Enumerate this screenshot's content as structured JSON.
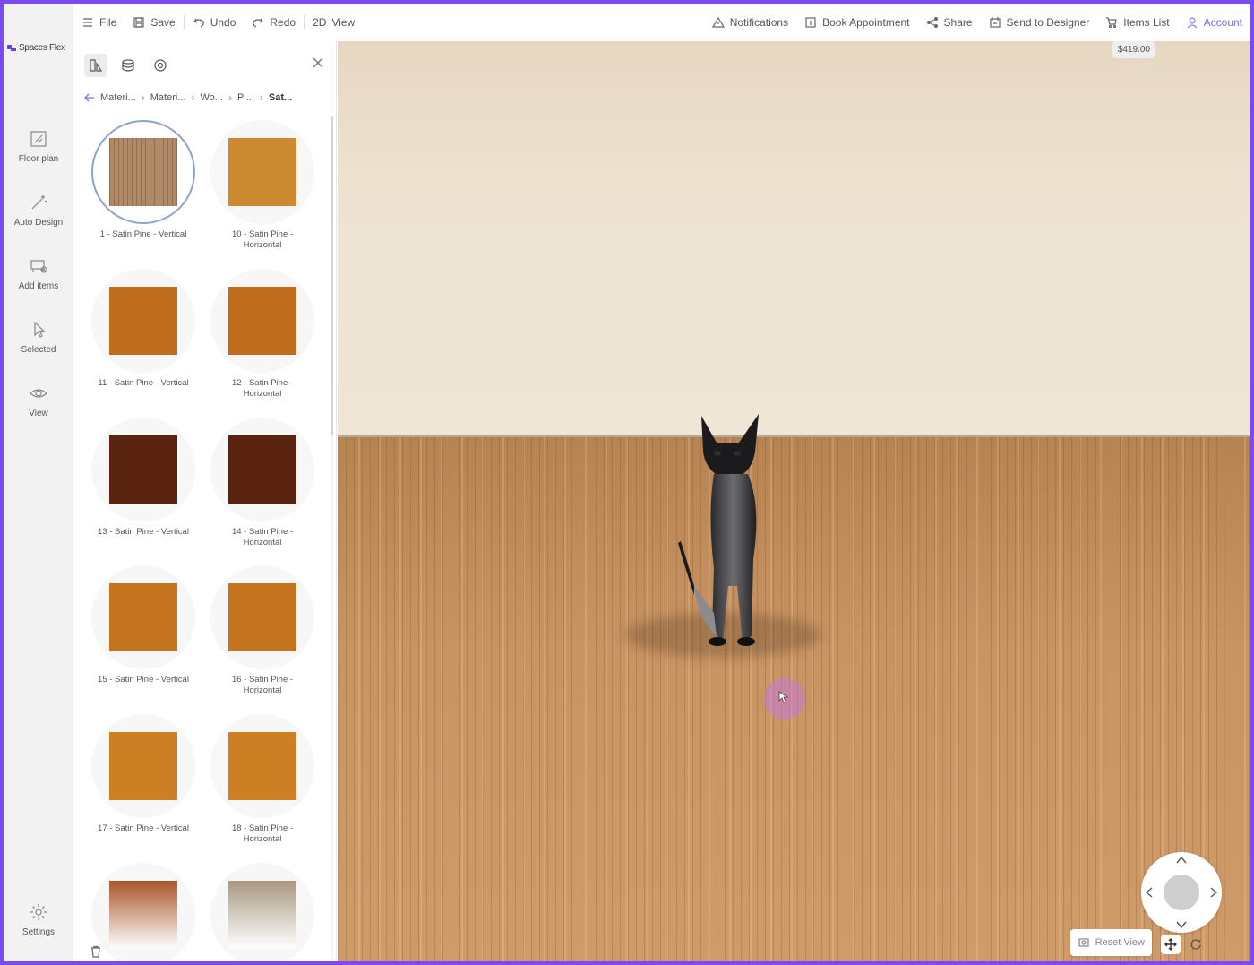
{
  "brand": {
    "name": "Spaces Flex",
    "accent": "#6b3fe0"
  },
  "rail": {
    "items": [
      {
        "label": "Floor plan",
        "icon": "floor-plan-icon"
      },
      {
        "label": "Auto Design",
        "icon": "magic-wand-icon"
      },
      {
        "label": "Add items",
        "icon": "add-items-icon"
      },
      {
        "label": "Selected",
        "icon": "cursor-icon"
      },
      {
        "label": "View",
        "icon": "eye-icon"
      }
    ],
    "settings_label": "Settings"
  },
  "toolbar": {
    "file": "File",
    "save": "Save",
    "undo": "Undo",
    "redo": "Redo",
    "view_toggle": "2D",
    "view": "View",
    "notifications": "Notifications",
    "book": "Book Appointment",
    "share": "Share",
    "send": "Send to Designer",
    "items_list": "Items List",
    "account": "Account"
  },
  "price": "$419.00",
  "breadcrumb": [
    "Materi...",
    "Materi...",
    "Wo...",
    "Pl...",
    "Sat..."
  ],
  "materials": [
    {
      "label": "1 - Satin Pine - Vertical",
      "color": "#b08a68",
      "selected": true
    },
    {
      "label": "10 - Satin Pine - Horizontal",
      "color": "#cc8a30"
    },
    {
      "label": "11 - Satin Pine - Vertical",
      "color": "#bf6d1d"
    },
    {
      "label": "12 - Satin Pine - Horizontal",
      "color": "#bf6d1d"
    },
    {
      "label": "13 - Satin Pine - Vertical",
      "color": "#5a2410"
    },
    {
      "label": "14 - Satin Pine - Horizontal",
      "color": "#5a2410"
    },
    {
      "label": "15 - Satin Pine - Vertical",
      "color": "#c4731f"
    },
    {
      "label": "16 - Satin Pine - Horizontal",
      "color": "#c4731f"
    },
    {
      "label": "17 - Satin Pine - Vertical",
      "color": "#cd7f24"
    },
    {
      "label": "18 - Satin Pine - Horizontal",
      "color": "#cd7f24"
    },
    {
      "label": "",
      "color": "#a8552a"
    },
    {
      "label": "",
      "color": "#a99880"
    }
  ],
  "viewport": {
    "reset_label": "Reset View"
  }
}
